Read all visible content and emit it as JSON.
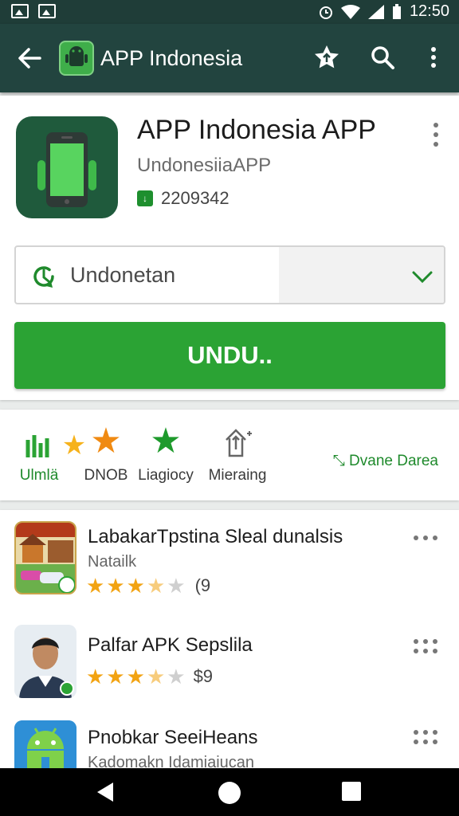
{
  "status_bar": {
    "time": "12:50"
  },
  "app_bar": {
    "title": "APP Indonesia",
    "back_icon": "arrow-back-icon",
    "logo_icon": "android-logo-icon",
    "actions": [
      "star-upload-icon",
      "search-icon",
      "more-vert-icon"
    ]
  },
  "app": {
    "title": "APP Indonesia APP",
    "developer": "UndonesiiaAPP",
    "stat_value": "2209342",
    "icon": "phone-icon"
  },
  "selector": {
    "value": "Undonetan",
    "icon": "refresh-icon"
  },
  "install_button": {
    "label": "UNDU.."
  },
  "stats": {
    "items": [
      {
        "label": "Ulmlä",
        "icon": "chart-icon"
      },
      {
        "label": "DNOB",
        "icon": "star-orange-icon"
      },
      {
        "label": "Liagiocy",
        "icon": "star-green-icon"
      },
      {
        "label": "Mieraing",
        "icon": "upload-icon"
      }
    ],
    "link": "Dvane Darea"
  },
  "list": [
    {
      "title": "LabakarTpstina Sleal dunalsis",
      "subtitle": "Natailk",
      "rating": 3.5,
      "rating_text": "(9",
      "thumb": "game-thumbnail"
    },
    {
      "title": "Palfar APK Sepslila",
      "subtitle": "",
      "rating": 3.5,
      "rating_text": "$9",
      "thumb": "person-avatar"
    },
    {
      "title": "Pnobkar SeeiHeans",
      "subtitle": "Kadomakn Idamiaiucan",
      "rating": null,
      "rating_text": "",
      "thumb": "android-icon"
    }
  ],
  "colors": {
    "app_bar": "#22443f",
    "accent_green": "#2ba334",
    "star": "#f2a312",
    "link_green": "#1f8a2c"
  }
}
